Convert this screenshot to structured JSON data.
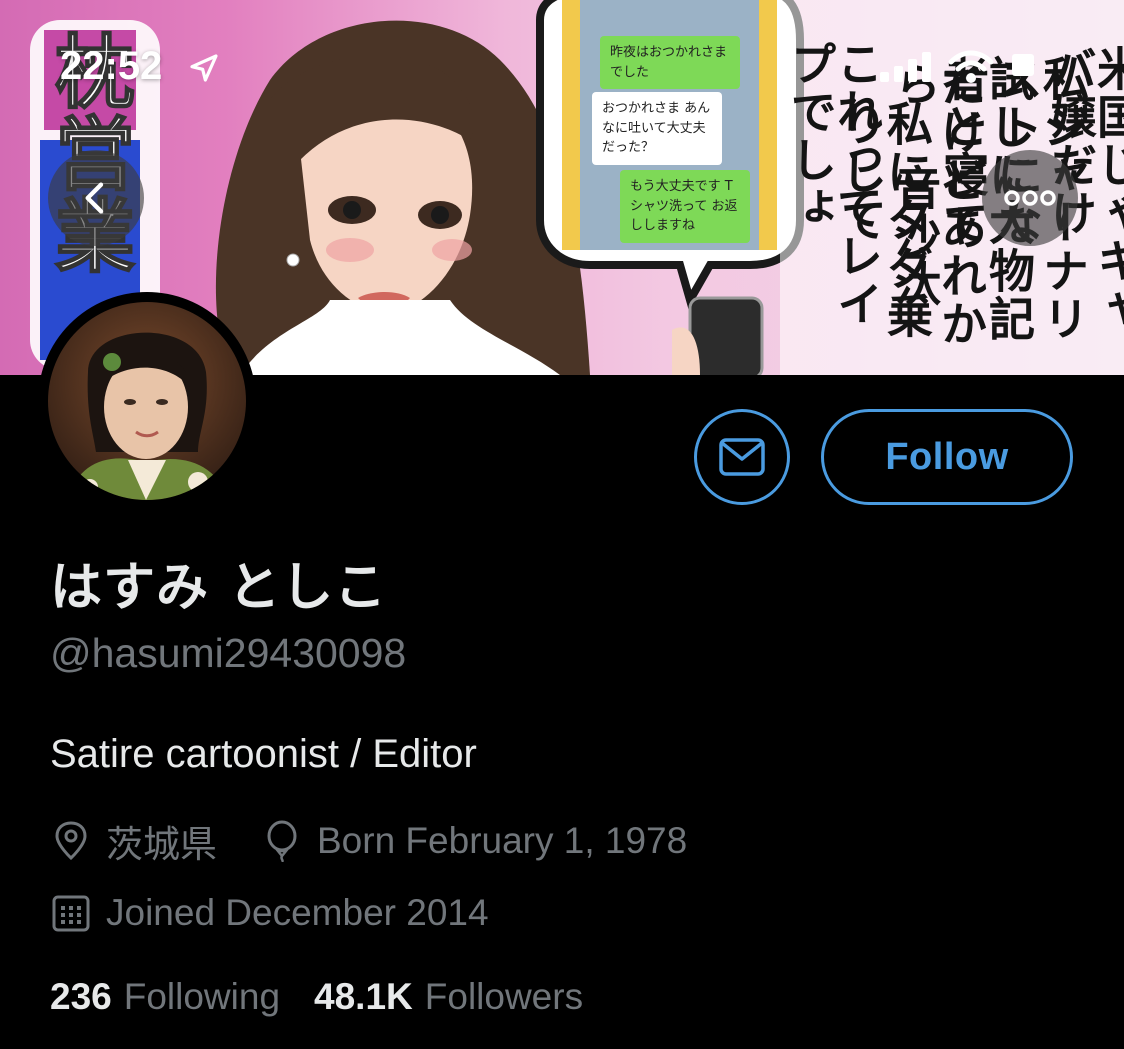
{
  "status_bar": {
    "time": "22:52"
  },
  "banner": {
    "bubble_messages": [
      "昨夜はおつかれさまでした",
      "おつかれさま あんなに吐いて大丈夫だった？",
      "もう大丈夫です Tシャツ洗って お返ししますね"
    ],
    "vertical_lines": [
      "米国じゃキャバ嬢だけ",
      "私ジャーナリストにな",
      "試しに大物記者と寝て",
      "だけどあれから 音沙汰",
      "私にタダ乗りして",
      "これってレイプでしょ"
    ],
    "left_title": "枕営業"
  },
  "profile": {
    "display_name": "はすみ としこ",
    "handle": "@hasumi29430098",
    "bio": "Satire cartoonist / Editor",
    "location": "茨城県",
    "birthday": "Born February 1, 1978",
    "joined": "Joined December 2014",
    "following_count": "236",
    "following_label": "Following",
    "followers_count": "48.1K",
    "followers_label": "Followers"
  },
  "actions": {
    "follow_label": "Follow"
  },
  "colors": {
    "accent": "#4a9be0",
    "muted": "#71767b",
    "text": "#e7e9ea",
    "background": "#000000"
  }
}
